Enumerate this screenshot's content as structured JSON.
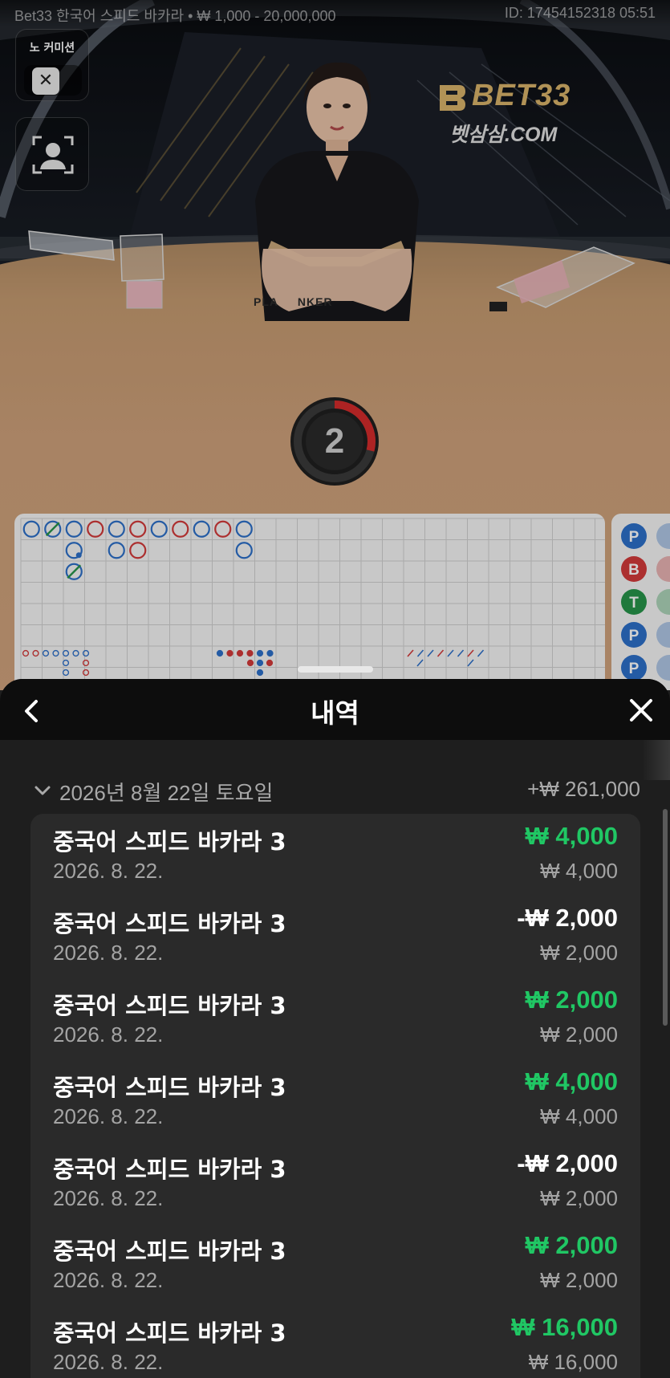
{
  "topbar": {
    "title": "Bet33 한국어 스피드 바카라 • ₩ 1,000 - 20,000,000",
    "game_id": "ID: 17454152318 05:51"
  },
  "video": {
    "no_commission_label": "노 커미션",
    "no_commission_enabled": false,
    "logo_main": "BET33",
    "logo_sub": "벳삼삼.COM",
    "table_print": "PLA     NKER",
    "timer_value": "2"
  },
  "roadmap": {
    "big_road_row1": [
      "P",
      "T",
      "P",
      "B",
      "P",
      "B",
      "P",
      "B",
      "P",
      "B",
      "P"
    ],
    "side_badges": [
      {
        "label": "P",
        "color": "#2d6fc9"
      },
      {
        "label": "B",
        "color": "#d23a3a"
      },
      {
        "label": "T",
        "color": "#27944a"
      },
      {
        "label": "P",
        "color": "#2d6fc9"
      },
      {
        "label": "P",
        "color": "#2d6fc9"
      }
    ]
  },
  "panel": {
    "title": "내역",
    "back_icon": "chevron-left-icon",
    "close_icon": "close-icon",
    "date_group": {
      "label": "2026년 8월 22일 토요일",
      "total": "+₩ 261,000"
    },
    "rows": [
      {
        "game": "중국어 스피드 바카라 3",
        "date": "2026. 8. 22.",
        "result": "₩ 4,000",
        "bet": "₩ 4,000",
        "outcome": "win"
      },
      {
        "game": "중국어 스피드 바카라 3",
        "date": "2026. 8. 22.",
        "result": "-₩ 2,000",
        "bet": "₩ 2,000",
        "outcome": "loss"
      },
      {
        "game": "중국어 스피드 바카라 3",
        "date": "2026. 8. 22.",
        "result": "₩ 2,000",
        "bet": "₩ 2,000",
        "outcome": "win"
      },
      {
        "game": "중국어 스피드 바카라 3",
        "date": "2026. 8. 22.",
        "result": "₩ 4,000",
        "bet": "₩ 4,000",
        "outcome": "win"
      },
      {
        "game": "중국어 스피드 바카라 3",
        "date": "2026. 8. 22.",
        "result": "-₩ 2,000",
        "bet": "₩ 2,000",
        "outcome": "loss"
      },
      {
        "game": "중국어 스피드 바카라 3",
        "date": "2026. 8. 22.",
        "result": "₩ 2,000",
        "bet": "₩ 2,000",
        "outcome": "win"
      },
      {
        "game": "중국어 스피드 바카라 3",
        "date": "2026. 8. 22.",
        "result": "₩ 16,000",
        "bet": "₩ 16,000",
        "outcome": "win"
      }
    ]
  },
  "colors": {
    "win": "#20c764",
    "player": "#2d6fc9",
    "banker": "#d23a3a",
    "tie": "#27944a",
    "timer_arc": "#d42b2b"
  }
}
